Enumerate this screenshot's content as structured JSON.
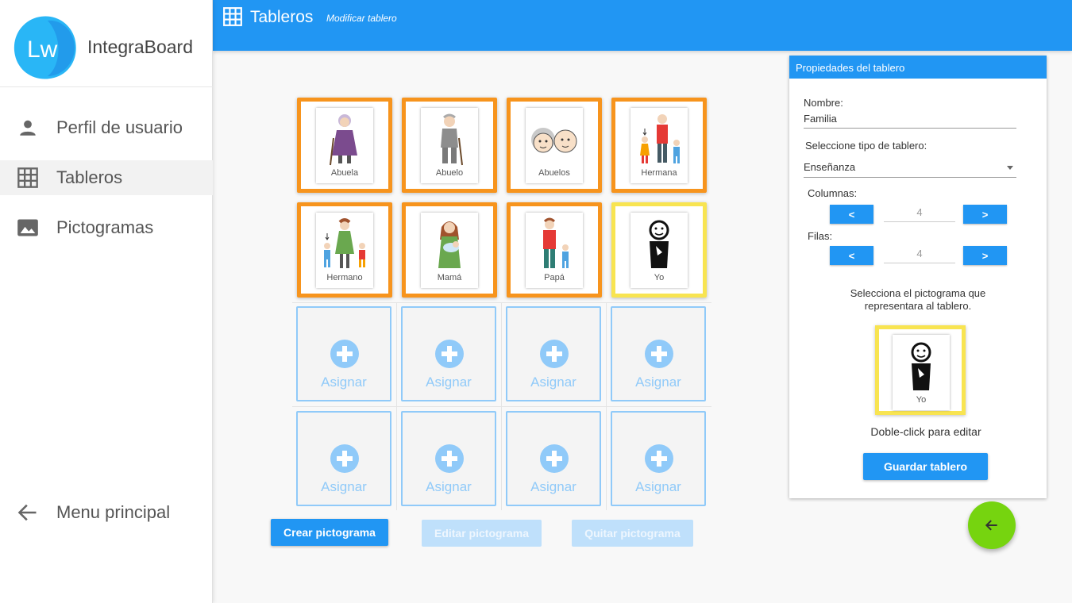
{
  "app": {
    "title": "IntegraBoard",
    "logo_text": "Lw"
  },
  "sidebar": {
    "items": [
      {
        "label": "Perfil de usuario",
        "icon": "person-icon"
      },
      {
        "label": "Tableros",
        "icon": "grid-icon"
      },
      {
        "label": "Pictogramas",
        "icon": "image-icon"
      }
    ],
    "back": {
      "label": "Menu principal",
      "icon": "arrow-left-icon"
    }
  },
  "header": {
    "title": "Tableros",
    "subtitle": "Modificar tablero"
  },
  "board": {
    "rows": [
      [
        {
          "label": "Abuela",
          "picto": "grandmother-icon",
          "border": "#f7941d"
        },
        {
          "label": "Abuelo",
          "picto": "grandfather-icon",
          "border": "#f7941d"
        },
        {
          "label": "Abuelos",
          "picto": "grandparents-icon",
          "border": "#f7941d"
        },
        {
          "label": "Hermana",
          "picto": "sister-icon",
          "border": "#f7941d"
        }
      ],
      [
        {
          "label": "Hermano",
          "picto": "brother-icon",
          "border": "#f7941d"
        },
        {
          "label": "Mamá",
          "picto": "mother-icon",
          "border": "#f7941d"
        },
        {
          "label": "Papá",
          "picto": "father-icon",
          "border": "#f7941d"
        },
        {
          "label": "Yo",
          "picto": "me-icon",
          "border": "#f8e451"
        }
      ]
    ],
    "empty_label": "Asignar",
    "empty_rows": 2
  },
  "actions": {
    "create": "Crear pictograma",
    "edit": "Editar pictograma",
    "remove": "Quitar pictograma"
  },
  "panel": {
    "header": "Propiedades del tablero",
    "name_label": "Nombre:",
    "name_value": "Familia",
    "type_label": "Seleccione tipo de tablero:",
    "type_value": "Enseñanza",
    "columns_label": "Columnas:",
    "columns_value": "4",
    "rows_label": "Filas:",
    "rows_value": "4",
    "dec": "<",
    "inc": ">",
    "select_text_1": "Selecciona el pictograma que",
    "select_text_2": "representara al tablero.",
    "preview_label": "Yo",
    "dblclick_text": "Doble-click para editar",
    "save_label": "Guardar tablero"
  },
  "colors": {
    "primary": "#2196f3",
    "orange": "#f7941d",
    "yellow": "#f8e451",
    "fab": "#76d40f",
    "light_blue": "#90caf9"
  }
}
